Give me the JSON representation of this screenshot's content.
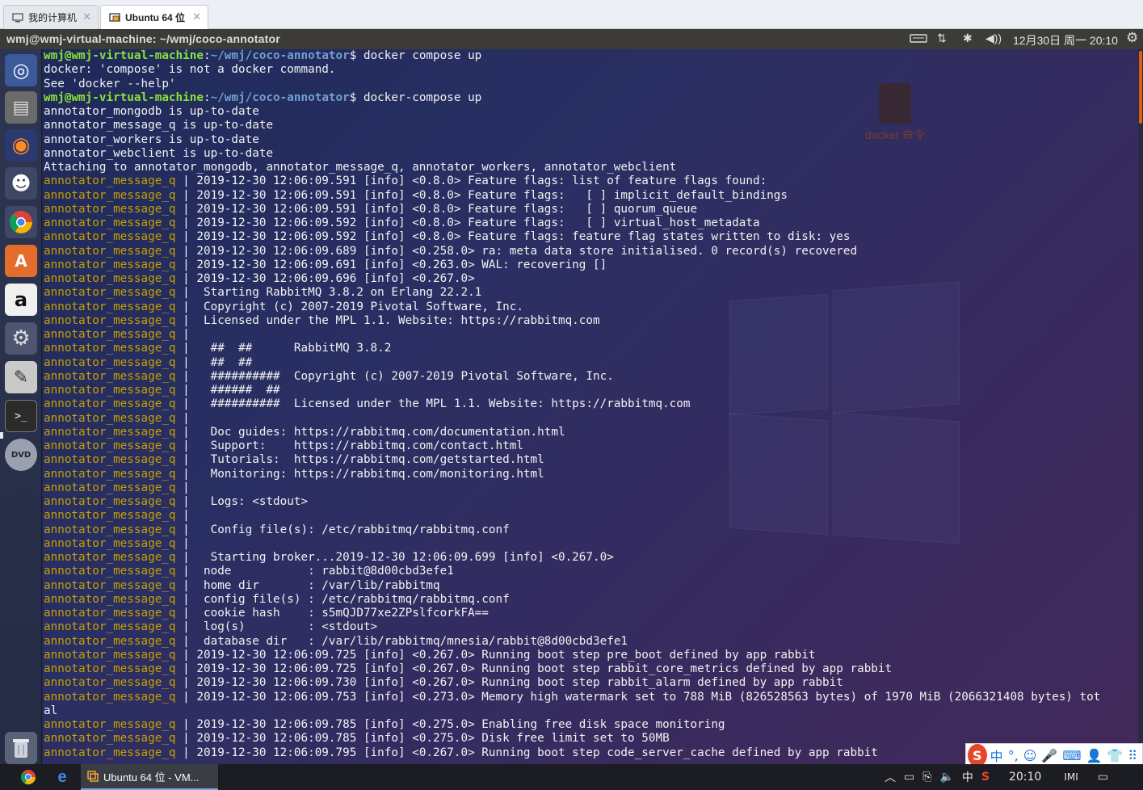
{
  "vm_tabs": [
    {
      "label": "我的计算机",
      "icon": "computer-icon",
      "active": false
    },
    {
      "label": "Ubuntu 64 位",
      "icon": "vm-icon",
      "active": true
    }
  ],
  "top_panel": {
    "window_title": "wmj@wmj-virtual-machine: ~/wmj/coco-annotator",
    "indicators": [
      "keyboard-icon",
      "network-icon",
      "bluetooth-icon",
      "volume-icon"
    ],
    "clock": "12月30日 周一 20:10",
    "gear_icon": "gear-icon"
  },
  "launcher": [
    {
      "name": "ubuntu-dash",
      "glyph": "◎"
    },
    {
      "name": "files",
      "glyph": "▤"
    },
    {
      "name": "firefox",
      "glyph": "◉"
    },
    {
      "name": "qq",
      "glyph": "☻"
    },
    {
      "name": "chrome",
      "glyph": "◍"
    },
    {
      "name": "software-center",
      "glyph": "A"
    },
    {
      "name": "amazon",
      "glyph": "a"
    },
    {
      "name": "system-settings",
      "glyph": "⚙"
    },
    {
      "name": "text-editor",
      "glyph": "✎"
    },
    {
      "name": "terminal",
      "glyph": ">_"
    },
    {
      "name": "dvd",
      "glyph": "DVD"
    },
    {
      "name": "trash",
      "glyph": "🗑"
    }
  ],
  "desktop_icon": {
    "label": "docker 命令"
  },
  "terminal": {
    "prompt_user": "wmj@wmj-virtual-machine",
    "prompt_path": "~/wmj/coco-annotator",
    "lines": [
      {
        "t": "prompt",
        "cmd": "docker compose up"
      },
      {
        "t": "plain",
        "text": "docker: 'compose' is not a docker command."
      },
      {
        "t": "plain",
        "text": "See 'docker --help'"
      },
      {
        "t": "prompt",
        "cmd": "docker-compose up"
      },
      {
        "t": "plain",
        "text": "annotator_mongodb is up-to-date"
      },
      {
        "t": "plain",
        "text": "annotator_message_q is up-to-date"
      },
      {
        "t": "plain",
        "text": "annotator_workers is up-to-date"
      },
      {
        "t": "plain",
        "text": "annotator_webclient is up-to-date"
      },
      {
        "t": "plain",
        "text": "Attaching to annotator_mongodb, annotator_message_q, annotator_workers, annotator_webclient"
      },
      {
        "t": "log",
        "text": "2019-12-30 12:06:09.591 [info] <0.8.0> Feature flags: list of feature flags found:"
      },
      {
        "t": "log",
        "text": "2019-12-30 12:06:09.591 [info] <0.8.0> Feature flags:   [ ] implicit_default_bindings"
      },
      {
        "t": "log",
        "text": "2019-12-30 12:06:09.591 [info] <0.8.0> Feature flags:   [ ] quorum_queue"
      },
      {
        "t": "log",
        "text": "2019-12-30 12:06:09.592 [info] <0.8.0> Feature flags:   [ ] virtual_host_metadata"
      },
      {
        "t": "log",
        "text": "2019-12-30 12:06:09.592 [info] <0.8.0> Feature flags: feature flag states written to disk: yes"
      },
      {
        "t": "log",
        "text": "2019-12-30 12:06:09.689 [info] <0.258.0> ra: meta data store initialised. 0 record(s) recovered"
      },
      {
        "t": "log",
        "text": "2019-12-30 12:06:09.691 [info] <0.263.0> WAL: recovering []"
      },
      {
        "t": "log",
        "text": "2019-12-30 12:06:09.696 [info] <0.267.0>"
      },
      {
        "t": "log",
        "text": " Starting RabbitMQ 3.8.2 on Erlang 22.2.1"
      },
      {
        "t": "log",
        "text": " Copyright (c) 2007-2019 Pivotal Software, Inc."
      },
      {
        "t": "log",
        "text": " Licensed under the MPL 1.1. Website: https://rabbitmq.com"
      },
      {
        "t": "log",
        "text": ""
      },
      {
        "t": "log",
        "text": "  ##  ##      RabbitMQ 3.8.2"
      },
      {
        "t": "log",
        "text": "  ##  ##"
      },
      {
        "t": "log",
        "text": "  ##########  Copyright (c) 2007-2019 Pivotal Software, Inc."
      },
      {
        "t": "log",
        "text": "  ######  ##"
      },
      {
        "t": "log",
        "text": "  ##########  Licensed under the MPL 1.1. Website: https://rabbitmq.com"
      },
      {
        "t": "log",
        "text": ""
      },
      {
        "t": "log",
        "text": "  Doc guides: https://rabbitmq.com/documentation.html"
      },
      {
        "t": "log",
        "text": "  Support:    https://rabbitmq.com/contact.html"
      },
      {
        "t": "log",
        "text": "  Tutorials:  https://rabbitmq.com/getstarted.html"
      },
      {
        "t": "log",
        "text": "  Monitoring: https://rabbitmq.com/monitoring.html"
      },
      {
        "t": "log",
        "text": ""
      },
      {
        "t": "log",
        "text": "  Logs: <stdout>"
      },
      {
        "t": "log",
        "text": ""
      },
      {
        "t": "log",
        "text": "  Config file(s): /etc/rabbitmq/rabbitmq.conf"
      },
      {
        "t": "log",
        "text": ""
      },
      {
        "t": "log",
        "text": "  Starting broker...2019-12-30 12:06:09.699 [info] <0.267.0>"
      },
      {
        "t": "log",
        "text": " node           : rabbit@8d00cbd3efe1"
      },
      {
        "t": "log",
        "text": " home dir       : /var/lib/rabbitmq"
      },
      {
        "t": "log",
        "text": " config file(s) : /etc/rabbitmq/rabbitmq.conf"
      },
      {
        "t": "log",
        "text": " cookie hash    : s5mQJD77xe2ZPslfcorkFA=="
      },
      {
        "t": "log",
        "text": " log(s)         : <stdout>"
      },
      {
        "t": "log",
        "text": " database dir   : /var/lib/rabbitmq/mnesia/rabbit@8d00cbd3efe1"
      },
      {
        "t": "log",
        "text": "2019-12-30 12:06:09.725 [info] <0.267.0> Running boot step pre_boot defined by app rabbit"
      },
      {
        "t": "log",
        "text": "2019-12-30 12:06:09.725 [info] <0.267.0> Running boot step rabbit_core_metrics defined by app rabbit"
      },
      {
        "t": "log",
        "text": "2019-12-30 12:06:09.730 [info] <0.267.0> Running boot step rabbit_alarm defined by app rabbit"
      },
      {
        "t": "log",
        "text": "2019-12-30 12:06:09.753 [info] <0.273.0> Memory high watermark set to 788 MiB (826528563 bytes) of 1970 MiB (2066321408 bytes) tot"
      },
      {
        "t": "plain",
        "text": "al"
      },
      {
        "t": "log",
        "text": "2019-12-30 12:06:09.785 [info] <0.275.0> Enabling free disk space monitoring"
      },
      {
        "t": "log",
        "text": "2019-12-30 12:06:09.785 [info] <0.275.0> Disk free limit set to 50MB"
      },
      {
        "t": "log",
        "text": "2019-12-30 12:06:09.795 [info] <0.267.0> Running boot step code_server_cache defined by app rabbit"
      }
    ],
    "log_prefix": "annotator_message_q | "
  },
  "ime_bar": {
    "items": [
      "中",
      "°,",
      "☺",
      "🎤",
      "⌨",
      "👤",
      "👕",
      "⠿"
    ]
  },
  "taskbar": {
    "task_label": "Ubuntu 64 位 - VM...",
    "tray": {
      "ime": "中",
      "time": "20:10"
    }
  },
  "colors": {
    "prompt_user": "#8ae234",
    "prompt_path": "#729fcf",
    "log_prefix": "#c4a000",
    "scroll_thumb": "#d8620f"
  }
}
